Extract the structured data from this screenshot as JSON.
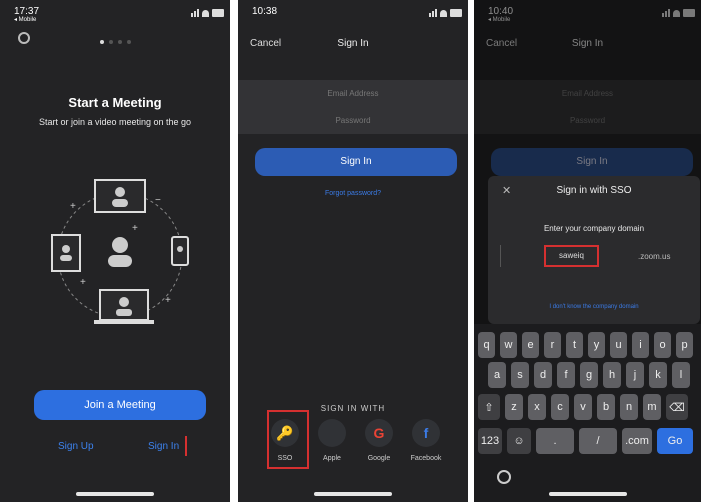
{
  "screen1": {
    "status_time": "17:37",
    "status_sub": "◂ Mobile",
    "title": "Start a Meeting",
    "subtitle": "Start or join a video meeting on the go",
    "join_button": "Join a Meeting",
    "sign_up": "Sign Up",
    "sign_in": "Sign In"
  },
  "screen2": {
    "status_time": "10:38",
    "cancel": "Cancel",
    "title": "Sign In",
    "email_placeholder": "Email Address",
    "password_placeholder": "Password",
    "sign_in_button": "Sign In",
    "forgot": "Forgot password?",
    "sign_in_with": "SIGN IN WITH",
    "providers": [
      {
        "label": "SSO",
        "icon": "key-icon",
        "glyph": "🔑",
        "color": "#cccccc"
      },
      {
        "label": "Apple",
        "icon": "apple-icon",
        "glyph": "",
        "color": "#ffffff"
      },
      {
        "label": "Google",
        "icon": "google-icon",
        "glyph": "G",
        "color": "#ea4335"
      },
      {
        "label": "Facebook",
        "icon": "facebook-icon",
        "glyph": "f",
        "color": "#3b7be6"
      }
    ]
  },
  "screen3": {
    "status_time": "10:40",
    "status_sub": "◂ Mobile",
    "cancel": "Cancel",
    "title": "Sign In",
    "email_placeholder": "Email Address",
    "password_placeholder": "Password",
    "sign_in_button": "Sign In",
    "modal_title": "Sign in with SSO",
    "modal_prompt": "Enter your company domain",
    "domain_value": "saweiq",
    "domain_suffix": ".zoom.us",
    "modal_link": "I don't know the company domain",
    "keyboard": {
      "row1": [
        "q",
        "w",
        "e",
        "r",
        "t",
        "y",
        "u",
        "i",
        "o",
        "p"
      ],
      "row2": [
        "a",
        "s",
        "d",
        "f",
        "g",
        "h",
        "j",
        "k",
        "l"
      ],
      "row3": [
        "⇧",
        "z",
        "x",
        "c",
        "v",
        "b",
        "n",
        "m",
        "⌫"
      ],
      "row4": [
        "123",
        "☺",
        ".",
        "/",
        ".com",
        "Go"
      ]
    }
  },
  "colors": {
    "accent": "#2d6fe0",
    "link": "#3b7be6",
    "highlight": "#d53030",
    "background": "#232325"
  }
}
